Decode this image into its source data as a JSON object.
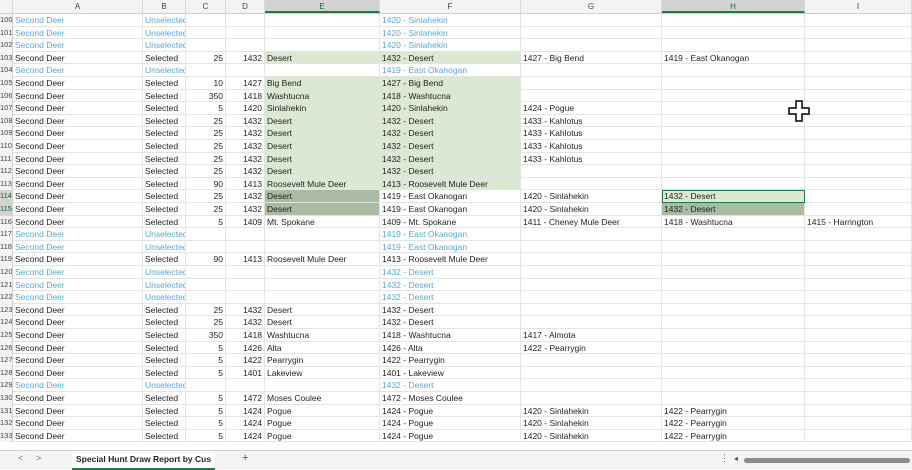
{
  "columns": [
    "A",
    "B",
    "C",
    "D",
    "E",
    "F",
    "G",
    "H",
    "I"
  ],
  "selected_columns": [
    "E",
    "H"
  ],
  "rows": [
    [
      "100",
      "Second Deer",
      "Unselected",
      "",
      "",
      "",
      "1420 - Sinlahekin",
      "",
      "",
      ""
    ],
    [
      "101",
      "Second Deer",
      "Unselected",
      "",
      "",
      "",
      "1420 - Sinlahekin",
      "",
      "",
      ""
    ],
    [
      "102",
      "Second Deer",
      "Unselected",
      "",
      "",
      "",
      "1420 - Sinlahekin",
      "",
      "",
      ""
    ],
    [
      "103",
      "Second Deer",
      "Selected",
      "25",
      "1432",
      "Desert",
      "1432 - Desert",
      "1427 - Big Bend",
      "1419 - East Okanogan",
      ""
    ],
    [
      "104",
      "Second Deer",
      "Unselected",
      "",
      "",
      "",
      "1419 - East Okanogan",
      "",
      "",
      ""
    ],
    [
      "105",
      "Second Deer",
      "Selected",
      "10",
      "1427",
      "Big Bend",
      "1427 - Big Bend",
      "",
      "",
      ""
    ],
    [
      "106",
      "Second Deer",
      "Selected",
      "350",
      "1418",
      "Washtucna",
      "1418 - Washtucna",
      "",
      "",
      ""
    ],
    [
      "107",
      "Second Deer",
      "Selected",
      "5",
      "1420",
      "Sinlahekin",
      "1420 - Sinlahekin",
      "1424 - Pogue",
      "",
      ""
    ],
    [
      "108",
      "Second Deer",
      "Selected",
      "25",
      "1432",
      "Desert",
      "1432 - Desert",
      "1433 - Kahlotus",
      "",
      ""
    ],
    [
      "109",
      "Second Deer",
      "Selected",
      "25",
      "1432",
      "Desert",
      "1432 - Desert",
      "1433 - Kahlotus",
      "",
      ""
    ],
    [
      "110",
      "Second Deer",
      "Selected",
      "25",
      "1432",
      "Desert",
      "1432 - Desert",
      "1433 - Kahlotus",
      "",
      ""
    ],
    [
      "111",
      "Second Deer",
      "Selected",
      "25",
      "1432",
      "Desert",
      "1432 - Desert",
      "1433 - Kahlotus",
      "",
      ""
    ],
    [
      "112",
      "Second Deer",
      "Selected",
      "25",
      "1432",
      "Desert",
      "1432 - Desert",
      "",
      "",
      ""
    ],
    [
      "113",
      "Second Deer",
      "Selected",
      "90",
      "1413",
      "Roosevelt Mule Deer",
      "1413 - Roosevelt Mule Deer",
      "",
      "",
      ""
    ],
    [
      "114",
      "Second Deer",
      "Selected",
      "25",
      "1432",
      "Desert",
      "1419 - East Okanogan",
      "1420 - Sinlahekin",
      "1432 - Desert",
      ""
    ],
    [
      "115",
      "Second Deer",
      "Selected",
      "25",
      "1432",
      "Desert",
      "1419 - East Okanogan",
      "1420 - Sinlahekin",
      "1432 - Desert",
      ""
    ],
    [
      "116",
      "Second Deer",
      "Selected",
      "5",
      "1409",
      "Mt. Spokane",
      "1409 - Mt. Spokane",
      "1411 - Cheney Mule Deer",
      "1418 - Washtucna",
      "1415 - Harrington"
    ],
    [
      "117",
      "Second Deer",
      "Unselected",
      "",
      "",
      "",
      "1419 - East Okanogan",
      "",
      "",
      ""
    ],
    [
      "118",
      "Second Deer",
      "Unselected",
      "",
      "",
      "",
      "1419 - East Okanogan",
      "",
      "",
      ""
    ],
    [
      "119",
      "Second Deer",
      "Selected",
      "90",
      "1413",
      "Roosevelt Mule Deer",
      "1413 - Roosevelt Mule Deer",
      "",
      "",
      ""
    ],
    [
      "120",
      "Second Deer",
      "Unselected",
      "",
      "",
      "",
      "1432 - Desert",
      "",
      "",
      ""
    ],
    [
      "121",
      "Second Deer",
      "Unselected",
      "",
      "",
      "",
      "1432 - Desert",
      "",
      "",
      ""
    ],
    [
      "122",
      "Second Deer",
      "Unselected",
      "",
      "",
      "",
      "1432 - Desert",
      "",
      "",
      ""
    ],
    [
      "123",
      "Second Deer",
      "Selected",
      "25",
      "1432",
      "Desert",
      "1432 - Desert",
      "",
      "",
      ""
    ],
    [
      "124",
      "Second Deer",
      "Selected",
      "25",
      "1432",
      "Desert",
      "1432 - Desert",
      "",
      "",
      ""
    ],
    [
      "125",
      "Second Deer",
      "Selected",
      "350",
      "1418",
      "Washtucna",
      "1418 - Washtucna",
      "1417 - Almota",
      "",
      ""
    ],
    [
      "126",
      "Second Deer",
      "Selected",
      "5",
      "1426",
      "Alta",
      "1426 - Alta",
      "1422 - Pearrygin",
      "",
      ""
    ],
    [
      "127",
      "Second Deer",
      "Selected",
      "5",
      "1422",
      "Pearrygin",
      "1422 - Pearrygin",
      "",
      "",
      ""
    ],
    [
      "128",
      "Second Deer",
      "Selected",
      "5",
      "1401",
      "Lakeview",
      "1401 - Lakeview",
      "",
      "",
      ""
    ],
    [
      "129",
      "Second Deer",
      "Unselected",
      "",
      "",
      "",
      "1432 - Desert",
      "",
      "",
      ""
    ],
    [
      "130",
      "Second Deer",
      "Selected",
      "5",
      "1472",
      "Moses Coulee",
      "1472 - Moses Coulee",
      "",
      "",
      ""
    ],
    [
      "131",
      "Second Deer",
      "Selected",
      "5",
      "1424",
      "Pogue",
      "1424 - Pogue",
      "1420 - Sinlahekin",
      "1422 - Pearrygin",
      ""
    ],
    [
      "132",
      "Second Deer",
      "Selected",
      "5",
      "1424",
      "Pogue",
      "1424 - Pogue",
      "1420 - Sinlahekin",
      "1422 - Pearrygin",
      ""
    ],
    [
      "133",
      "Second Deer",
      "Selected",
      "5",
      "1424",
      "Pogue",
      "1424 - Pogue",
      "1420 - Sinlahekin",
      "1422 - Pearrygin",
      ""
    ]
  ],
  "sheet_tab": "Special Hunt Draw Report by Cus",
  "add_sheet": "+",
  "nav_prev": "<",
  "nav_next": ">",
  "more": "⋮",
  "colors": {
    "highlight": "#dbe9d2",
    "dark_highlight": "#a9bba3",
    "unselected_text": "#5aa7d6",
    "accent": "#1e7b44"
  }
}
